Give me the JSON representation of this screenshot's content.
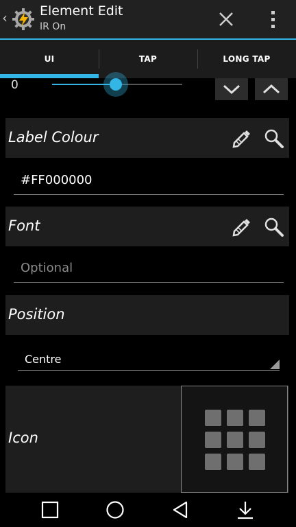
{
  "actionbar": {
    "title": "Element Edit",
    "subtitle": "IR On",
    "back_icon": "chevron-left-icon",
    "logo_icon": "tasker-gear-bolt-icon",
    "close_icon": "close-icon",
    "more_icon": "overflow-menu-icon"
  },
  "tabs": [
    {
      "label": "UI",
      "selected": true
    },
    {
      "label": "TAP",
      "selected": false
    },
    {
      "label": "LONG TAP",
      "selected": false
    }
  ],
  "slider": {
    "value_label": "0",
    "level": 0.49,
    "down_icon": "chevron-down-icon",
    "up_icon": "chevron-up-icon"
  },
  "label_colour": {
    "label": "Label Colour",
    "value": "#FF000000",
    "edit_icon": "pencil-icon",
    "search_icon": "search-icon"
  },
  "font": {
    "label": "Font",
    "placeholder": "Optional",
    "edit_icon": "pencil-icon",
    "search_icon": "search-icon"
  },
  "position": {
    "label": "Position",
    "selected": "Centre"
  },
  "icon": {
    "label": "Icon",
    "preview_icon": "grid-icon"
  },
  "navbar": {
    "recents_icon": "square-icon",
    "home_icon": "circle-icon",
    "back_icon": "triangle-back-icon",
    "download_icon": "download-arrow-icon"
  },
  "colors": {
    "accent": "#33b5e5",
    "background": "#000000",
    "section_bg": "#1e1e1e",
    "actionbar_bg": "#212121"
  }
}
